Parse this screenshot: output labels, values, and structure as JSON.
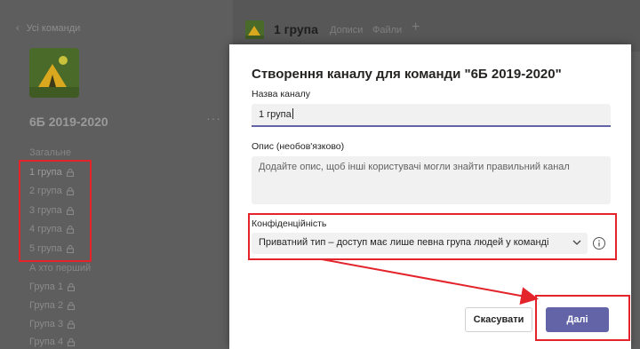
{
  "sidebar": {
    "back_label": "Усі команди",
    "team_name": "6Б 2019-2020",
    "more": "···",
    "sections": [
      {
        "title": "Загальне"
      },
      {
        "title": "А хто перший"
      }
    ],
    "channels_private": [
      "1 група",
      "2 група",
      "3 група",
      "4 група",
      "5 група"
    ],
    "channels_second": [
      "Група 1",
      "Група 2",
      "Група 3",
      "Група 4"
    ]
  },
  "channel_header": {
    "title": "1 група",
    "tabs": [
      "Дописи",
      "Файли"
    ],
    "add": "+"
  },
  "dialog": {
    "title": "Створення каналу для команди \"6Б 2019-2020\"",
    "name_label": "Назва каналу",
    "name_value": "1 група",
    "desc_label": "Опис (необов'язково)",
    "desc_placeholder": "Додайте опис, щоб інші користувачі могли знайти правильний канал",
    "privacy_label": "Конфіденційність",
    "privacy_value": "Приватний тип – доступ має лише певна група людей у команді",
    "cancel_label": "Скасувати",
    "next_label": "Далі"
  },
  "colors": {
    "accent": "#6264a7",
    "highlight": "#e3242b"
  }
}
